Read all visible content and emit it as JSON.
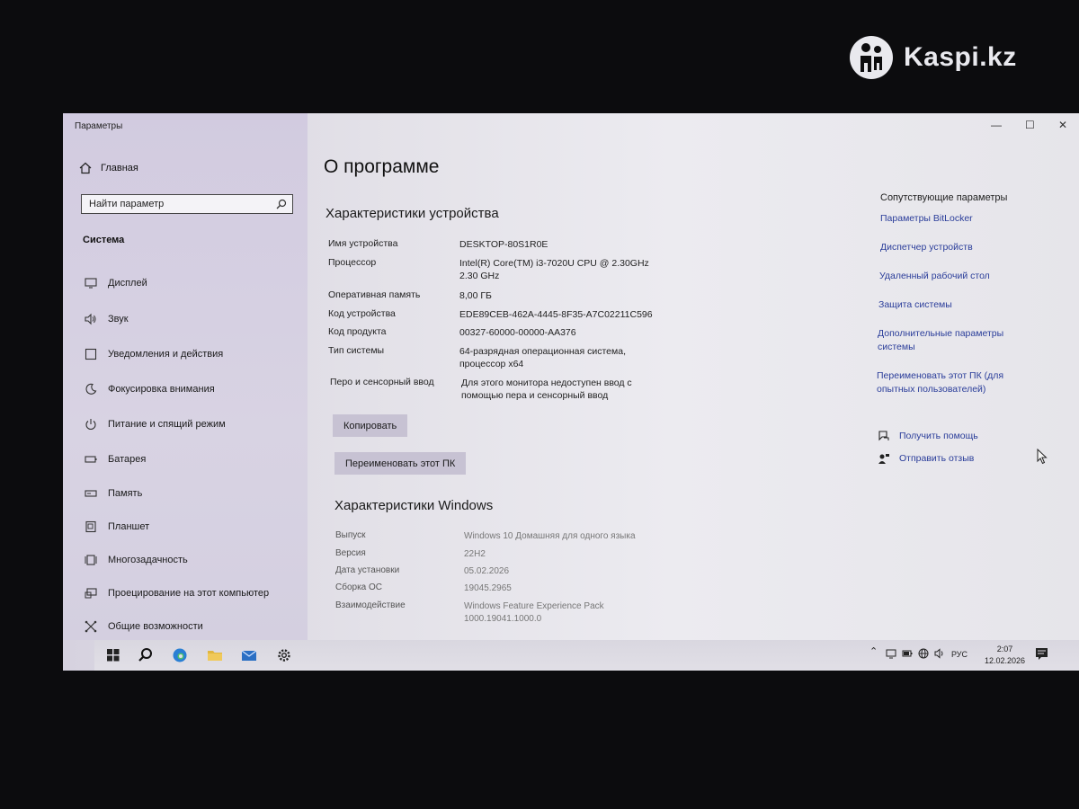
{
  "watermark": {
    "text": "Kaspi.kz"
  },
  "window": {
    "title": "Параметры",
    "controls": [
      "—",
      "☐",
      "✕"
    ]
  },
  "sidebar": {
    "home_label": "Главная",
    "search_placeholder": "Найти параметр",
    "section_label": "Система",
    "items": [
      {
        "label": "Дисплей",
        "icon": "display-icon"
      },
      {
        "label": "Звук",
        "icon": "sound-icon"
      },
      {
        "label": "Уведомления и действия",
        "icon": "notifications-icon"
      },
      {
        "label": "Фокусировка внимания",
        "icon": "focus-assist-icon"
      },
      {
        "label": "Питание и спящий режим",
        "icon": "power-icon"
      },
      {
        "label": "Батарея",
        "icon": "battery-icon"
      },
      {
        "label": "Память",
        "icon": "storage-icon"
      },
      {
        "label": "Планшет",
        "icon": "tablet-icon"
      },
      {
        "label": "Многозадачность",
        "icon": "multitasking-icon"
      },
      {
        "label": "Проецирование на этот компьютер",
        "icon": "projecting-icon"
      },
      {
        "label": "Общие возможности",
        "icon": "shared-experiences-icon"
      }
    ]
  },
  "main": {
    "page_title": "О программе",
    "device_section_title": "Характеристики устройства",
    "device_specs": [
      {
        "label": "Имя устройства",
        "value": "DESKTOP-80S1R0E"
      },
      {
        "label": "Процессор",
        "value": "Intel(R) Core(TM) i3-7020U CPU @ 2.30GHz 2.30 GHz"
      },
      {
        "label": "Оперативная память",
        "value": "8,00 ГБ"
      },
      {
        "label": "Код устройства",
        "value": "EDE89CEB-462A-4445-8F35-A7C02211C596"
      },
      {
        "label": "Код продукта",
        "value": "00327-60000-00000-AA376"
      },
      {
        "label": "Тип системы",
        "value": "64-разрядная операционная система, процессор x64"
      },
      {
        "label": "Перо и сенсорный ввод",
        "value": "Для этого монитора недоступен ввод с помощью пера и сенсорный ввод"
      }
    ],
    "copy_button": "Копировать",
    "rename_button": "Переименовать этот ПК",
    "windows_section_title": "Характеристики Windows",
    "windows_specs": [
      {
        "label": "Выпуск",
        "value": "Windows 10 Домашняя для одного языка"
      },
      {
        "label": "Версия",
        "value": "22H2"
      },
      {
        "label": "Дата установки",
        "value": "05.02.2026"
      },
      {
        "label": "Сборка ОС",
        "value": "19045.2965"
      },
      {
        "label": "Взаимодействие",
        "value": "Windows Feature Experience Pack 1000.19041.1000.0"
      }
    ]
  },
  "related": {
    "title": "Сопутствующие параметры",
    "links": [
      "Параметры BitLocker",
      "Диспетчер устройств",
      "Удаленный рабочий стол",
      "Защита системы",
      "Дополнительные параметры системы",
      "Переименовать этот ПК (для опытных пользователей)"
    ],
    "help": "Получить помощь",
    "feedback": "Отправить отзыв"
  },
  "taskbar": {
    "language": "РУС",
    "time": "2:07",
    "date": "12.02.2026"
  }
}
